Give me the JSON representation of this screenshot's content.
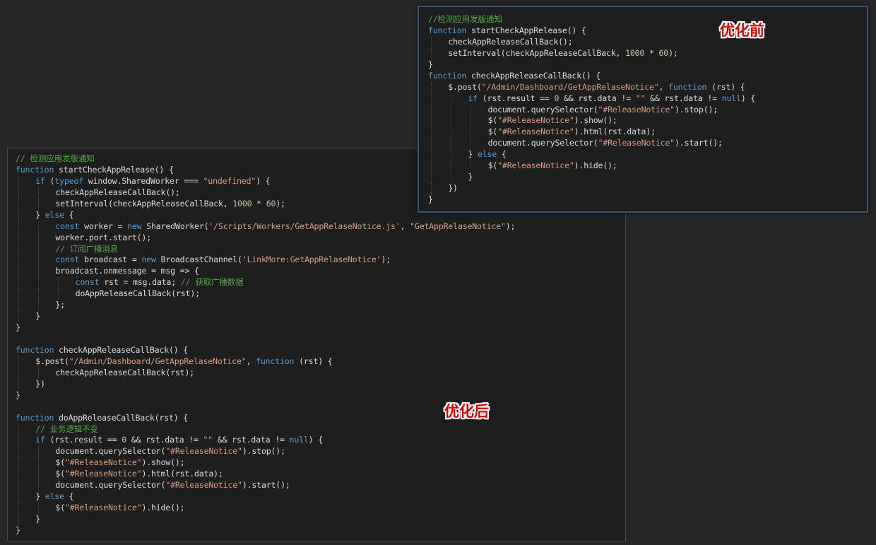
{
  "labels": {
    "before": "优化前",
    "after": "优化后"
  },
  "colors": {
    "background": "#262626",
    "editor_bg": "#1e1e1e",
    "comment": "#57a64a",
    "keyword": "#569cd6",
    "string": "#d69d85",
    "number": "#b5cea8",
    "text": "#dcdcdc",
    "label": "#e00000"
  },
  "before_code": [
    {
      "indent": 0,
      "tokens": [
        [
          "com",
          "//检测应用发版通知"
        ]
      ]
    },
    {
      "indent": 0,
      "tokens": [
        [
          "kw",
          "function"
        ],
        [
          "txt",
          " startCheckAppRelease() {"
        ]
      ]
    },
    {
      "indent": 1,
      "tokens": [
        [
          "txt",
          "checkAppReleaseCallBack();"
        ]
      ]
    },
    {
      "indent": 1,
      "tokens": [
        [
          "txt",
          "setInterval(checkAppReleaseCallBack, "
        ],
        [
          "num",
          "1000"
        ],
        [
          "txt",
          " * "
        ],
        [
          "num",
          "60"
        ],
        [
          "txt",
          ");"
        ]
      ]
    },
    {
      "indent": 0,
      "tokens": [
        [
          "txt",
          "}"
        ]
      ]
    },
    {
      "indent": 0,
      "tokens": [
        [
          "kw",
          "function"
        ],
        [
          "txt",
          " checkAppReleaseCallBack() {"
        ]
      ]
    },
    {
      "indent": 1,
      "tokens": [
        [
          "txt",
          "$.post("
        ],
        [
          "str",
          "\"/Admin/Dashboard/GetAppRelaseNotice\""
        ],
        [
          "txt",
          ", "
        ],
        [
          "kw",
          "function"
        ],
        [
          "txt",
          " (rst) {"
        ]
      ]
    },
    {
      "indent": 2,
      "tokens": [
        [
          "kw",
          "if"
        ],
        [
          "txt",
          " (rst.result == "
        ],
        [
          "num",
          "0"
        ],
        [
          "txt",
          " && rst.data != "
        ],
        [
          "str",
          "\"\""
        ],
        [
          "txt",
          " && rst.data != "
        ],
        [
          "kw",
          "null"
        ],
        [
          "txt",
          ") {"
        ]
      ]
    },
    {
      "indent": 3,
      "tokens": [
        [
          "txt",
          "document.querySelector("
        ],
        [
          "str",
          "\"#ReleaseNotice\""
        ],
        [
          "txt",
          ").stop();"
        ]
      ]
    },
    {
      "indent": 3,
      "tokens": [
        [
          "txt",
          "$("
        ],
        [
          "str",
          "\"#ReleaseNotice\""
        ],
        [
          "txt",
          ").show();"
        ]
      ]
    },
    {
      "indent": 3,
      "tokens": [
        [
          "txt",
          "$("
        ],
        [
          "str",
          "\"#ReleaseNotice\""
        ],
        [
          "txt",
          ").html(rst.data);"
        ]
      ]
    },
    {
      "indent": 3,
      "tokens": [
        [
          "txt",
          "document.querySelector("
        ],
        [
          "str",
          "\"#ReleaseNotice\""
        ],
        [
          "txt",
          ").start();"
        ]
      ]
    },
    {
      "indent": 2,
      "tokens": [
        [
          "txt",
          "} "
        ],
        [
          "kw",
          "else"
        ],
        [
          "txt",
          " {"
        ]
      ]
    },
    {
      "indent": 3,
      "tokens": [
        [
          "txt",
          "$("
        ],
        [
          "str",
          "\"#ReleaseNotice\""
        ],
        [
          "txt",
          ").hide();"
        ]
      ]
    },
    {
      "indent": 2,
      "tokens": [
        [
          "txt",
          "}"
        ]
      ]
    },
    {
      "indent": 1,
      "tokens": [
        [
          "txt",
          "})"
        ]
      ]
    },
    {
      "indent": 0,
      "tokens": [
        [
          "txt",
          "}"
        ]
      ]
    }
  ],
  "after_code": [
    {
      "indent": 0,
      "tokens": [
        [
          "com",
          "// 检测应用发版通知"
        ]
      ]
    },
    {
      "indent": 0,
      "tokens": [
        [
          "kw",
          "function"
        ],
        [
          "txt",
          " startCheckAppRelease() {"
        ]
      ]
    },
    {
      "indent": 1,
      "tokens": [
        [
          "kw",
          "if"
        ],
        [
          "txt",
          " ("
        ],
        [
          "kw",
          "typeof"
        ],
        [
          "txt",
          " window.SharedWorker === "
        ],
        [
          "str",
          "\"undefined\""
        ],
        [
          "txt",
          ") {"
        ]
      ]
    },
    {
      "indent": 2,
      "tokens": [
        [
          "txt",
          "checkAppReleaseCallBack();"
        ]
      ]
    },
    {
      "indent": 2,
      "tokens": [
        [
          "txt",
          "setInterval(checkAppReleaseCallBack, "
        ],
        [
          "num",
          "1000"
        ],
        [
          "txt",
          " * "
        ],
        [
          "num",
          "60"
        ],
        [
          "txt",
          ");"
        ]
      ]
    },
    {
      "indent": 1,
      "tokens": [
        [
          "txt",
          "} "
        ],
        [
          "kw",
          "else"
        ],
        [
          "txt",
          " {"
        ]
      ]
    },
    {
      "indent": 2,
      "tokens": [
        [
          "kw",
          "const"
        ],
        [
          "txt",
          " worker = "
        ],
        [
          "kw",
          "new"
        ],
        [
          "txt",
          " SharedWorker("
        ],
        [
          "str",
          "'/Scripts/Workers/GetAppRelaseNotice.js'"
        ],
        [
          "txt",
          ", "
        ],
        [
          "str",
          "\"GetAppRelaseNotice\""
        ],
        [
          "txt",
          ");"
        ]
      ]
    },
    {
      "indent": 2,
      "tokens": [
        [
          "txt",
          "worker.port.start();"
        ]
      ]
    },
    {
      "indent": 2,
      "tokens": [
        [
          "com",
          "// 订阅广播消息"
        ]
      ]
    },
    {
      "indent": 2,
      "tokens": [
        [
          "kw",
          "const"
        ],
        [
          "txt",
          " broadcast = "
        ],
        [
          "kw",
          "new"
        ],
        [
          "txt",
          " BroadcastChannel("
        ],
        [
          "str",
          "'LinkMore:GetAppRelaseNotice'"
        ],
        [
          "txt",
          ");"
        ]
      ]
    },
    {
      "indent": 2,
      "tokens": [
        [
          "txt",
          "broadcast.onmessage = msg => {"
        ]
      ]
    },
    {
      "indent": 3,
      "tokens": [
        [
          "kw",
          "const"
        ],
        [
          "txt",
          " rst = msg.data; "
        ],
        [
          "com",
          "// 获取广播数据"
        ]
      ]
    },
    {
      "indent": 3,
      "tokens": [
        [
          "txt",
          "doAppReleaseCallBack(rst);"
        ]
      ]
    },
    {
      "indent": 2,
      "tokens": [
        [
          "txt",
          "};"
        ]
      ]
    },
    {
      "indent": 1,
      "tokens": [
        [
          "txt",
          "}"
        ]
      ]
    },
    {
      "indent": 0,
      "tokens": [
        [
          "txt",
          "}"
        ]
      ]
    },
    {
      "indent": 0,
      "tokens": []
    },
    {
      "indent": 0,
      "tokens": [
        [
          "kw",
          "function"
        ],
        [
          "txt",
          " checkAppReleaseCallBack() {"
        ]
      ]
    },
    {
      "indent": 1,
      "tokens": [
        [
          "txt",
          "$.post("
        ],
        [
          "str",
          "\"/Admin/Dashboard/GetAppRelaseNotice\""
        ],
        [
          "txt",
          ", "
        ],
        [
          "kw",
          "function"
        ],
        [
          "txt",
          " (rst) {"
        ]
      ]
    },
    {
      "indent": 2,
      "tokens": [
        [
          "txt",
          "checkAppReleaseCallBack(rst);"
        ]
      ]
    },
    {
      "indent": 1,
      "tokens": [
        [
          "txt",
          "})"
        ]
      ]
    },
    {
      "indent": 0,
      "tokens": [
        [
          "txt",
          "}"
        ]
      ]
    },
    {
      "indent": 0,
      "tokens": []
    },
    {
      "indent": 0,
      "tokens": [
        [
          "kw",
          "function"
        ],
        [
          "txt",
          " doAppReleaseCallBack(rst) {"
        ]
      ]
    },
    {
      "indent": 1,
      "tokens": [
        [
          "com",
          "// 业务逻辑不变"
        ]
      ]
    },
    {
      "indent": 1,
      "tokens": [
        [
          "kw",
          "if"
        ],
        [
          "txt",
          " (rst.result == "
        ],
        [
          "num",
          "0"
        ],
        [
          "txt",
          " && rst.data != "
        ],
        [
          "str",
          "\"\""
        ],
        [
          "txt",
          " && rst.data != "
        ],
        [
          "kw",
          "null"
        ],
        [
          "txt",
          ") {"
        ]
      ]
    },
    {
      "indent": 2,
      "tokens": [
        [
          "txt",
          "document.querySelector("
        ],
        [
          "str",
          "\"#ReleaseNotice\""
        ],
        [
          "txt",
          ").stop();"
        ]
      ]
    },
    {
      "indent": 2,
      "tokens": [
        [
          "txt",
          "$("
        ],
        [
          "str",
          "\"#ReleaseNotice\""
        ],
        [
          "txt",
          ").show();"
        ]
      ]
    },
    {
      "indent": 2,
      "tokens": [
        [
          "txt",
          "$("
        ],
        [
          "str",
          "\"#ReleaseNotice\""
        ],
        [
          "txt",
          ").html(rst.data);"
        ]
      ]
    },
    {
      "indent": 2,
      "tokens": [
        [
          "txt",
          "document.querySelector("
        ],
        [
          "str",
          "\"#ReleaseNotice\""
        ],
        [
          "txt",
          ").start();"
        ]
      ]
    },
    {
      "indent": 1,
      "tokens": [
        [
          "txt",
          "} "
        ],
        [
          "kw",
          "else"
        ],
        [
          "txt",
          " {"
        ]
      ]
    },
    {
      "indent": 2,
      "tokens": [
        [
          "txt",
          "$("
        ],
        [
          "str",
          "\"#ReleaseNotice\""
        ],
        [
          "txt",
          ").hide();"
        ]
      ]
    },
    {
      "indent": 1,
      "tokens": [
        [
          "txt",
          "}"
        ]
      ]
    },
    {
      "indent": 0,
      "tokens": [
        [
          "txt",
          "}"
        ]
      ]
    }
  ]
}
